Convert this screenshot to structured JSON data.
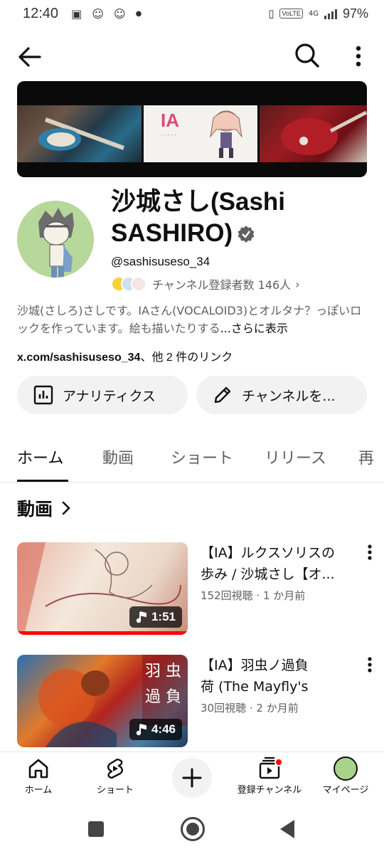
{
  "status_bar": {
    "time": "12:40",
    "network": "VoLTE",
    "signal": "4G",
    "battery": "97%"
  },
  "banner": {
    "art_text": "IA"
  },
  "channel": {
    "name": "沙城さし(Sashi SASHIRO)",
    "handle": "@sashisuseso_34",
    "subscribers": "チャンネル登録者数 146人",
    "description": "沙城(さしろ)さしです。IAさん(VOCALOID3)とオルタナ？っぽいロックを作っています。絵も描いたりする",
    "more_label": "...さらに表示",
    "link_main": "x.com/sashisuseso_34",
    "link_rest": "、他 2 件のリンク"
  },
  "actions": {
    "analytics": "アナリティクス",
    "edit": "チャンネルを..."
  },
  "tabs": [
    "ホーム",
    "動画",
    "ショート",
    "リリース",
    "再"
  ],
  "section": {
    "title": "動画"
  },
  "videos": [
    {
      "title": "【IA】ルクスソリスの\n歩み / 沙城さし【オ...",
      "meta": "152回視聴 · 1 か月前",
      "duration": "1:51"
    },
    {
      "title": "【IA】羽虫ノ過負\n荷 (The Mayfly's Overl...",
      "meta": "30回視聴 · 2 か月前",
      "duration": "4:46"
    }
  ],
  "bottom_nav": {
    "home": "ホーム",
    "shorts": "ショート",
    "subscriptions": "登録チャンネル",
    "you": "マイページ"
  },
  "colors": {
    "accent_red": "#ff0000",
    "text_primary": "#0f0f0f",
    "text_secondary": "#606060",
    "chip_bg": "#f2f2f2"
  }
}
